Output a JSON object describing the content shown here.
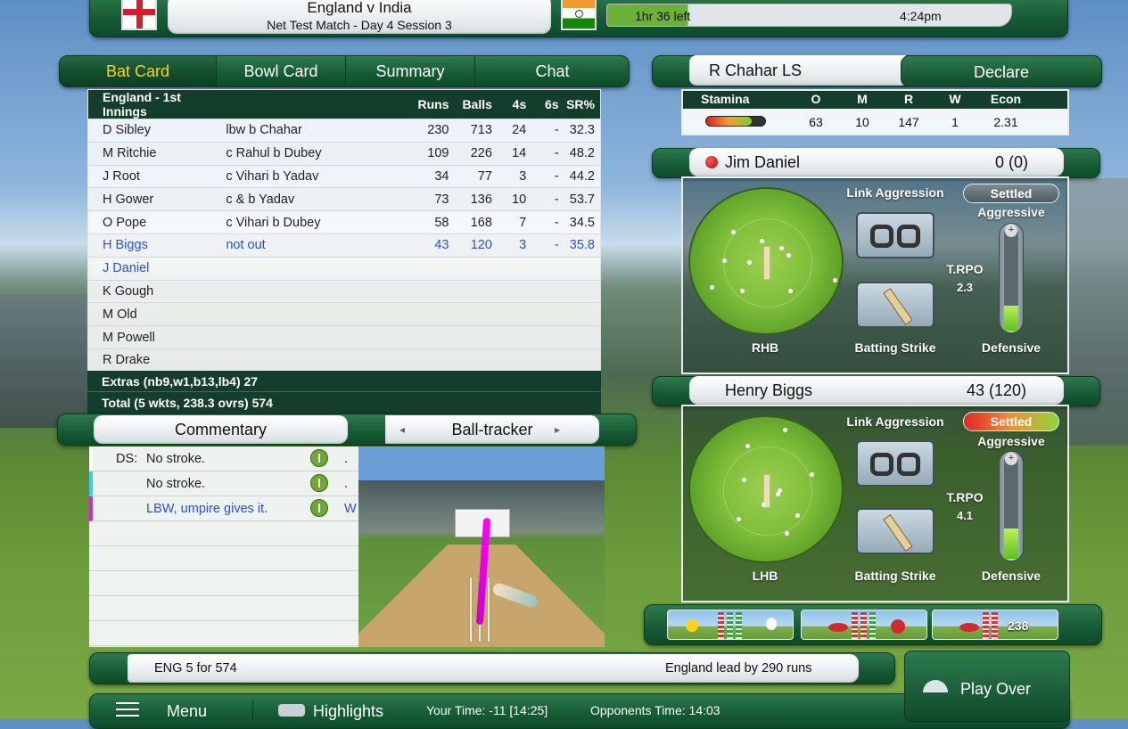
{
  "match": {
    "title": "England v India",
    "subtitle": "Net Test Match - Day 4 Session 3",
    "time_left": "1hr 36 left",
    "clock": "4:24pm"
  },
  "tabs": {
    "bat": "Bat Card",
    "bowl": "Bowl Card",
    "summary": "Summary",
    "chat": "Chat"
  },
  "batcard": {
    "headers": [
      "England - 1st Innings",
      "",
      "Runs",
      "Balls",
      "4s",
      "6s",
      "SR%"
    ],
    "rows": [
      [
        "D Sibley",
        "lbw b Chahar",
        "230",
        "713",
        "24",
        "-",
        "32.3"
      ],
      [
        "M Ritchie",
        "c Rahul b Dubey",
        "109",
        "226",
        "14",
        "-",
        "48.2"
      ],
      [
        "J Root",
        "c Vihari b Yadav",
        "34",
        "77",
        "3",
        "-",
        "44.2"
      ],
      [
        "H Gower",
        "c & b Yadav",
        "73",
        "136",
        "10",
        "-",
        "53.7"
      ],
      [
        "O Pope",
        "c Vihari b Dubey",
        "58",
        "168",
        "7",
        "-",
        "34.5"
      ],
      [
        "H Biggs",
        "not out",
        "43",
        "120",
        "3",
        "-",
        "35.8"
      ],
      [
        "J Daniel",
        "",
        "",
        "",
        "",
        "",
        ""
      ],
      [
        "K Gough",
        "",
        "",
        "",
        "",
        "",
        ""
      ],
      [
        "M Old",
        "",
        "",
        "",
        "",
        "",
        ""
      ],
      [
        "M Powell",
        "",
        "",
        "",
        "",
        "",
        ""
      ],
      [
        "R Drake",
        "",
        "",
        "",
        "",
        "",
        ""
      ]
    ],
    "extras": "Extras (nb9,w1,b13,lb4) 27",
    "total": "Total (5 wkts, 238.3 ovrs) 574"
  },
  "bowler": {
    "name": "R Chahar LS",
    "declare": "Declare",
    "headers": [
      "Stamina",
      "O",
      "M",
      "R",
      "W",
      "Econ"
    ],
    "values": [
      "",
      "63",
      "10",
      "147",
      "1",
      "2.31"
    ],
    "stamina_level": 0.78
  },
  "batsman1": {
    "name": "Jim Daniel",
    "score": "0 (0)",
    "hand": "RHB",
    "link": "Link Aggression",
    "mode": "Settled",
    "aggressive": "Aggressive",
    "defensive": "Defensive",
    "trpo_label": "T.RPO",
    "trpo": "2.3",
    "strike": "Batting Strike",
    "level": 0.25
  },
  "batsman2": {
    "name": "Henry Biggs",
    "score": "43 (120)",
    "hand": "LHB",
    "link": "Link Aggression",
    "mode": "Settled",
    "aggressive": "Aggressive",
    "defensive": "Defensive",
    "trpo_label": "T.RPO",
    "trpo": "4.1",
    "strike": "Batting Strike",
    "level": 0.3
  },
  "commentary": {
    "tab": "Commentary",
    "tracker": "Ball-tracker",
    "arrow_left": "◂",
    "arrow_right": "▸",
    "lines": [
      {
        "prefix": "DS:",
        "text": "No stroke.",
        "result": ".",
        "color": "#ffffff"
      },
      {
        "prefix": "",
        "text": "No stroke.",
        "result": ".",
        "color": "#2ed3e6"
      },
      {
        "prefix": "",
        "text": "LBW, umpire gives it.",
        "result": "W",
        "color": "#e021c8"
      }
    ]
  },
  "minis": {
    "third": "238"
  },
  "status": {
    "score": "ENG  5 for 574",
    "lead": "England lead by 290 runs"
  },
  "bottom": {
    "menu": "Menu",
    "highlights": "Highlights",
    "your_time": "Your Time: -11 [14:25]",
    "opp_time": "Opponents Time: 14:03",
    "play_over": "Play Over"
  }
}
